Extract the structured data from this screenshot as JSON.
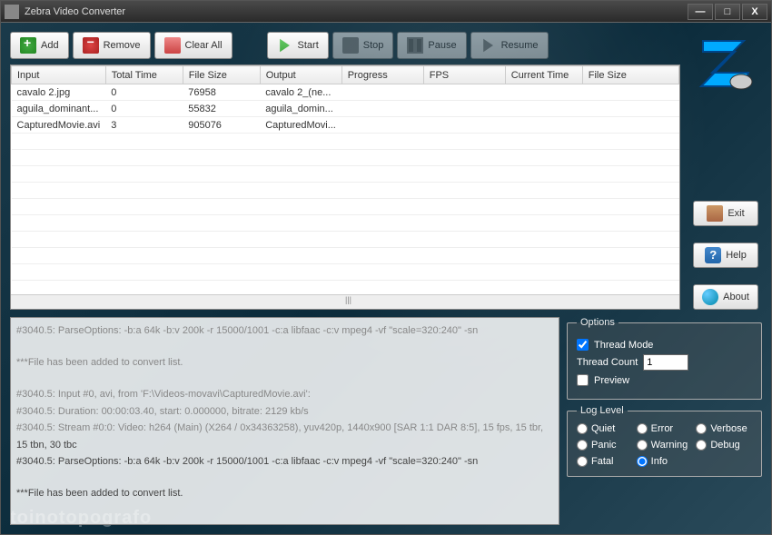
{
  "window": {
    "title": "Zebra Video Converter"
  },
  "toolbar": {
    "add": "Add",
    "remove": "Remove",
    "clear": "Clear All",
    "start": "Start",
    "stop": "Stop",
    "pause": "Pause",
    "resume": "Resume"
  },
  "side": {
    "exit": "Exit",
    "help": "Help",
    "about": "About"
  },
  "table": {
    "headers": {
      "input": "Input",
      "total_time": "Total Time",
      "file_size": "File Size",
      "output": "Output",
      "progress": "Progress",
      "fps": "FPS",
      "current_time": "Current Time",
      "file_size2": "File Size"
    },
    "rows": [
      {
        "input": "cavalo 2.jpg",
        "total_time": "0",
        "file_size": "76958",
        "output": "cavalo 2_(ne...",
        "progress": "",
        "fps": "",
        "current_time": "",
        "file_size2": ""
      },
      {
        "input": "aguila_dominant...",
        "total_time": "0",
        "file_size": "55832",
        "output": "aguila_domin...",
        "progress": "",
        "fps": "",
        "current_time": "",
        "file_size2": ""
      },
      {
        "input": "CapturedMovie.avi",
        "total_time": "3",
        "file_size": "905076",
        "output": "CapturedMovi...",
        "progress": "",
        "fps": "",
        "current_time": "",
        "file_size2": ""
      }
    ]
  },
  "log": {
    "l1": "#3040.5: ParseOptions:  -b:a 64k -b:v 200k -r 15000/1001 -c:a libfaac -c:v mpeg4 -vf \"scale=320:240\" -sn",
    "l2": "***File has been added to convert list.",
    "l3": "#3040.5: Input #0, avi, from 'F:\\Videos-movavi\\CapturedMovie.avi':",
    "l4": "#3040.5:   Duration: 00:00:03.40, start: 0.000000, bitrate: 2129 kb/s",
    "l5": "#3040.5:     Stream #0:0: Video: h264 (Main) (X264 / 0x34363258), yuv420p, 1440x900 [SAR 1:1 DAR 8:5], 15 fps, 15 tbr,",
    "l6": "15 tbn, 30 tbc",
    "l7": "#3040.5: ParseOptions:  -b:a 64k -b:v 200k -r 15000/1001 -c:a libfaac -c:v mpeg4 -vf \"scale=320:240\" -sn",
    "l8": "***File has been added to convert list."
  },
  "options": {
    "legend": "Options",
    "thread_mode": "Thread Mode",
    "thread_count_lbl": "Thread Count",
    "thread_count_val": "1",
    "preview": "Preview"
  },
  "loglevel": {
    "legend": "Log Level",
    "quiet": "Quiet",
    "error": "Error",
    "verbose": "Verbose",
    "panic": "Panic",
    "warning": "Warning",
    "debug": "Debug",
    "fatal": "Fatal",
    "info": "Info"
  },
  "watermark": "toinotopografo"
}
